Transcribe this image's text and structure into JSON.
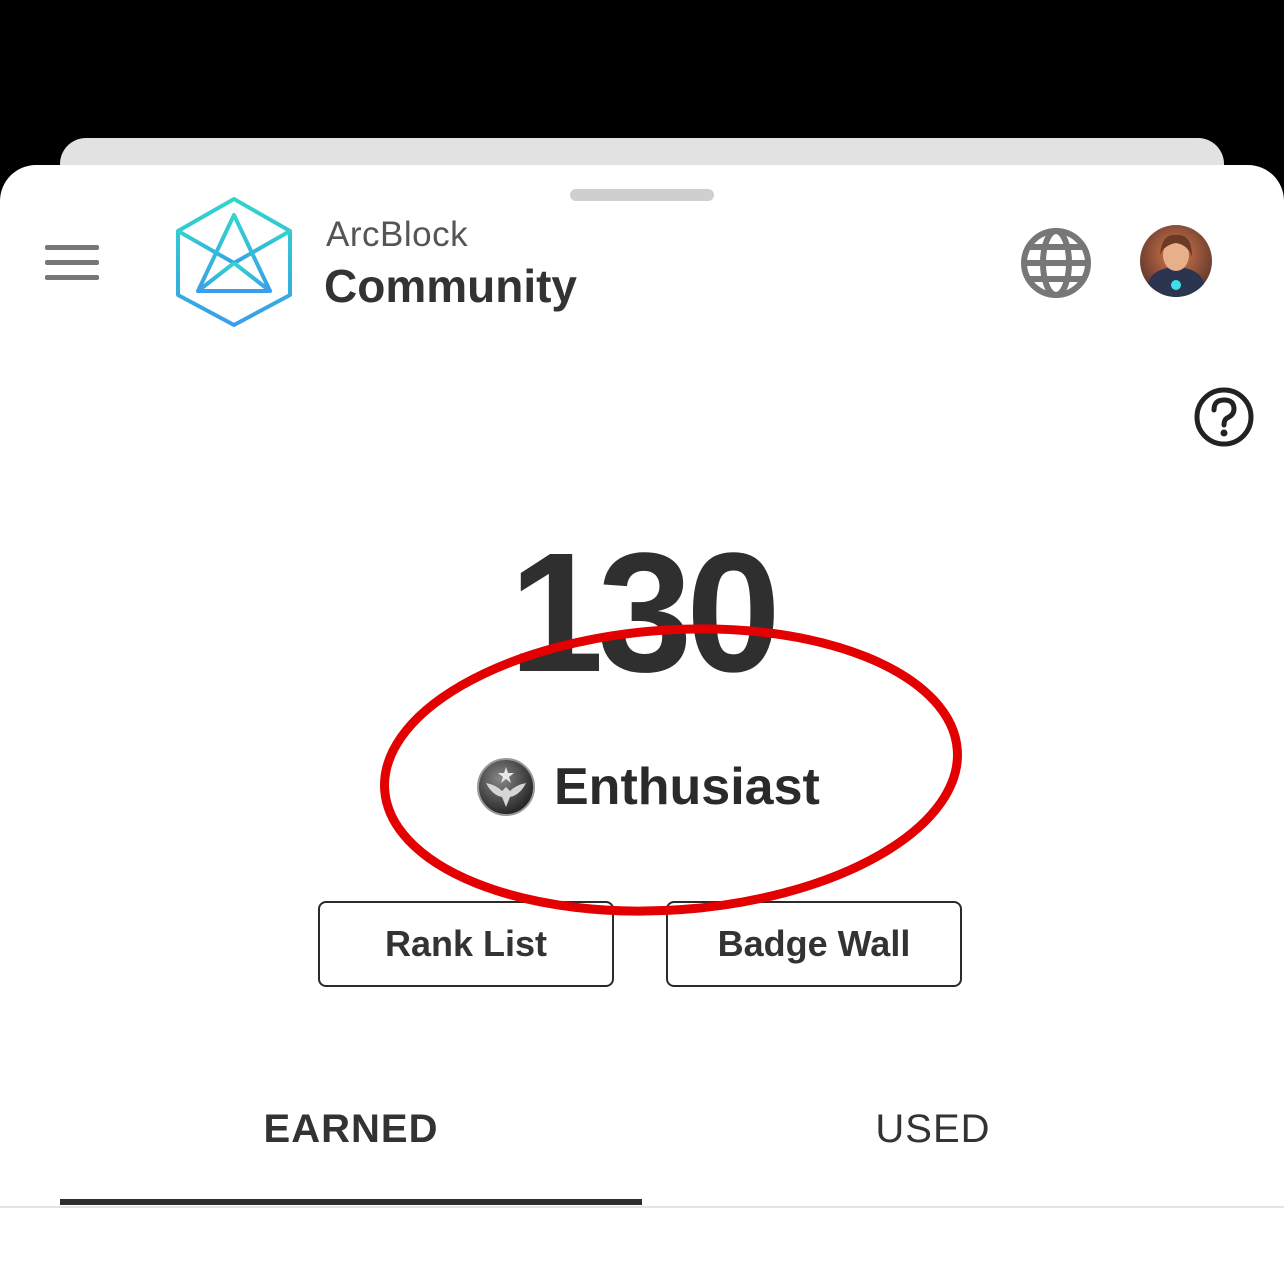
{
  "header": {
    "menu_icon": "hamburger-menu-icon",
    "brand_line1": "ArcBlock",
    "brand_line2": "Community",
    "logo_icon": "arcblock-cube-logo",
    "language_icon": "globe-icon",
    "avatar_icon": "user-avatar"
  },
  "points": {
    "help_icon": "question-circle-icon",
    "value": "130",
    "rank_label": "Enthusiast",
    "rank_icon": "eagle-badge-icon"
  },
  "actions": {
    "rank_list_label": "Rank List",
    "badge_wall_label": "Badge Wall"
  },
  "tabs": [
    {
      "label": "EARNED",
      "selected": true
    },
    {
      "label": "USED",
      "selected": false
    }
  ],
  "colors": {
    "annotation": "#e30000",
    "logo_teal": "#2fd0d0",
    "logo_blue": "#3aa8e8",
    "text_dark": "#2f2f2f"
  }
}
